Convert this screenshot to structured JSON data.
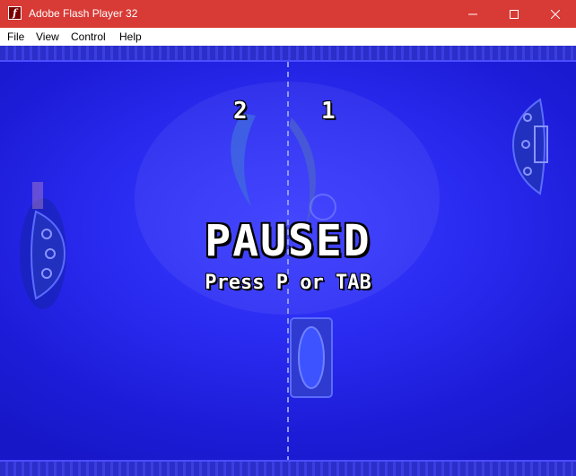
{
  "window": {
    "title": "Adobe Flash Player 32",
    "controls": [
      "minimize",
      "maximize",
      "close"
    ]
  },
  "menu": {
    "items": [
      "File",
      "View",
      "Control",
      "Help"
    ]
  },
  "game": {
    "score_left": "2",
    "score_right": "1",
    "paused_text": "PAUSED",
    "hint_text": "Press P or TAB"
  },
  "colors": {
    "titlebar": "#d83a35",
    "field": "#1a1ad8",
    "text": "#ffffff"
  },
  "icons": {
    "app": "flash-player-icon"
  }
}
